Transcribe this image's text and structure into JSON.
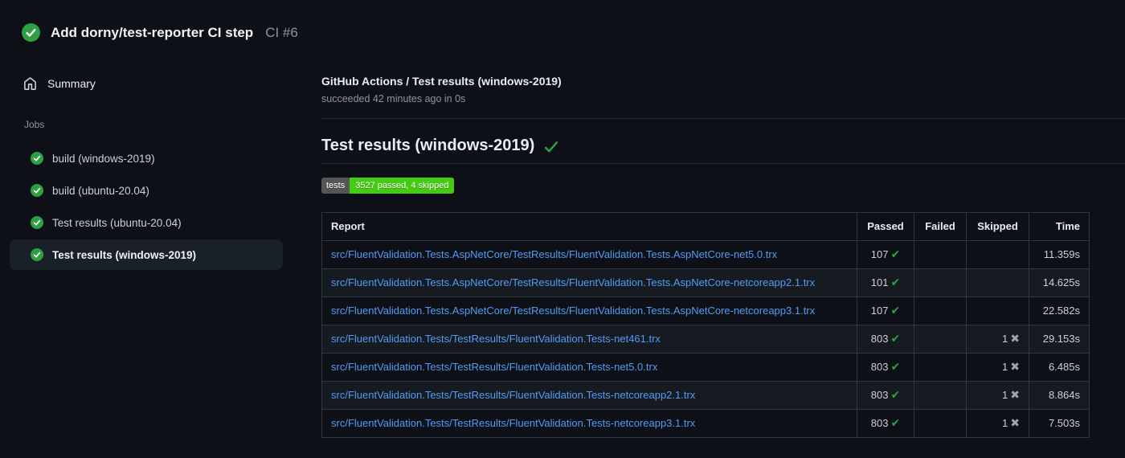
{
  "run_header": {
    "title": "Add dorny/test-reporter CI step",
    "run_number": "CI #6"
  },
  "sidebar": {
    "summary_label": "Summary",
    "jobs_label": "Jobs",
    "jobs": [
      {
        "label": "build (windows-2019)",
        "selected": false
      },
      {
        "label": "build (ubuntu-20.04)",
        "selected": false
      },
      {
        "label": "Test results (ubuntu-20.04)",
        "selected": false
      },
      {
        "label": "Test results (windows-2019)",
        "selected": true
      }
    ]
  },
  "main": {
    "check_title": "GitHub Actions / Test results (windows-2019)",
    "check_status": "succeeded 42 minutes ago in 0s",
    "section_heading": "Test results (windows-2019)",
    "badge": {
      "label": "tests",
      "value": "3527 passed, 4 skipped",
      "label_bg": "#555555",
      "value_bg": "#44cc11"
    },
    "table": {
      "columns": [
        "Report",
        "Passed",
        "Failed",
        "Skipped",
        "Time"
      ],
      "rows": [
        {
          "report": "src/FluentValidation.Tests.AspNetCore/TestResults/FluentValidation.Tests.AspNetCore-net5.0.trx",
          "passed": "107",
          "failed": "",
          "skipped": "",
          "time": "11.359s"
        },
        {
          "report": "src/FluentValidation.Tests.AspNetCore/TestResults/FluentValidation.Tests.AspNetCore-netcoreapp2.1.trx",
          "passed": "101",
          "failed": "",
          "skipped": "",
          "time": "14.625s"
        },
        {
          "report": "src/FluentValidation.Tests.AspNetCore/TestResults/FluentValidation.Tests.AspNetCore-netcoreapp3.1.trx",
          "passed": "107",
          "failed": "",
          "skipped": "",
          "time": "22.582s"
        },
        {
          "report": "src/FluentValidation.Tests/TestResults/FluentValidation.Tests-net461.trx",
          "passed": "803",
          "failed": "",
          "skipped": "1",
          "time": "29.153s"
        },
        {
          "report": "src/FluentValidation.Tests/TestResults/FluentValidation.Tests-net5.0.trx",
          "passed": "803",
          "failed": "",
          "skipped": "1",
          "time": "6.485s"
        },
        {
          "report": "src/FluentValidation.Tests/TestResults/FluentValidation.Tests-netcoreapp2.1.trx",
          "passed": "803",
          "failed": "",
          "skipped": "1",
          "time": "8.864s"
        },
        {
          "report": "src/FluentValidation.Tests/TestResults/FluentValidation.Tests-netcoreapp3.1.trx",
          "passed": "803",
          "failed": "",
          "skipped": "1",
          "time": "7.503s"
        }
      ]
    }
  },
  "icons": {
    "passed_glyph": "✔",
    "skipped_glyph": "✖"
  },
  "colors": {
    "success_green": "#2ea043",
    "link_blue": "#539bf5",
    "badge_green": "#44cc11",
    "badge_gray": "#555555",
    "page_bg": "#0d1117",
    "row_alt_bg": "#161b22",
    "selected_job_bg": "#1a2028"
  }
}
